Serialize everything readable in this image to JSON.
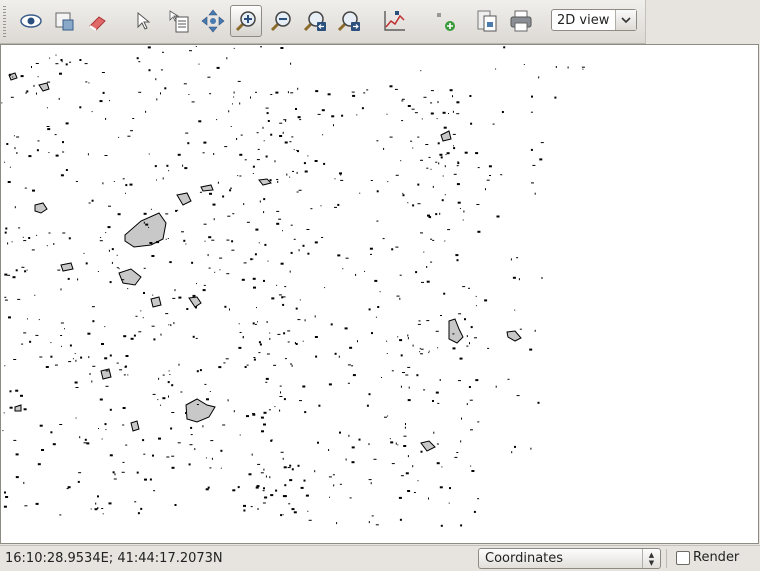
{
  "toolbar": {
    "tools": [
      {
        "name": "toggle-visibility",
        "icon": "eye-icon"
      },
      {
        "name": "overview",
        "icon": "overview-icon"
      },
      {
        "name": "clear-selection",
        "icon": "eraser-icon"
      },
      {
        "name": "select",
        "icon": "arrow-pointer-icon"
      },
      {
        "name": "identify",
        "icon": "identify-icon"
      },
      {
        "name": "pan",
        "icon": "pan-icon"
      },
      {
        "name": "zoom-in",
        "icon": "zoom-in-icon",
        "active": true
      },
      {
        "name": "zoom-out",
        "icon": "zoom-out-icon"
      },
      {
        "name": "zoom-previous",
        "icon": "zoom-previous-icon"
      },
      {
        "name": "zoom-next",
        "icon": "zoom-next-icon"
      },
      {
        "name": "profile",
        "icon": "profile-chart-icon"
      },
      {
        "name": "add-layer",
        "icon": "add-point-icon"
      },
      {
        "name": "copy",
        "icon": "copy-map-icon"
      },
      {
        "name": "print",
        "icon": "print-icon"
      }
    ],
    "view_mode": "2D view"
  },
  "status": {
    "coordinates": "16:10:28.9534E; 41:44:17.2073N",
    "display_mode": "Coordinates",
    "render_label": "Render",
    "render_checked": false
  },
  "colors": {
    "polygon_fill": "#c8c8c8",
    "polygon_stroke": "#000000",
    "map_background": "#ffffff"
  }
}
